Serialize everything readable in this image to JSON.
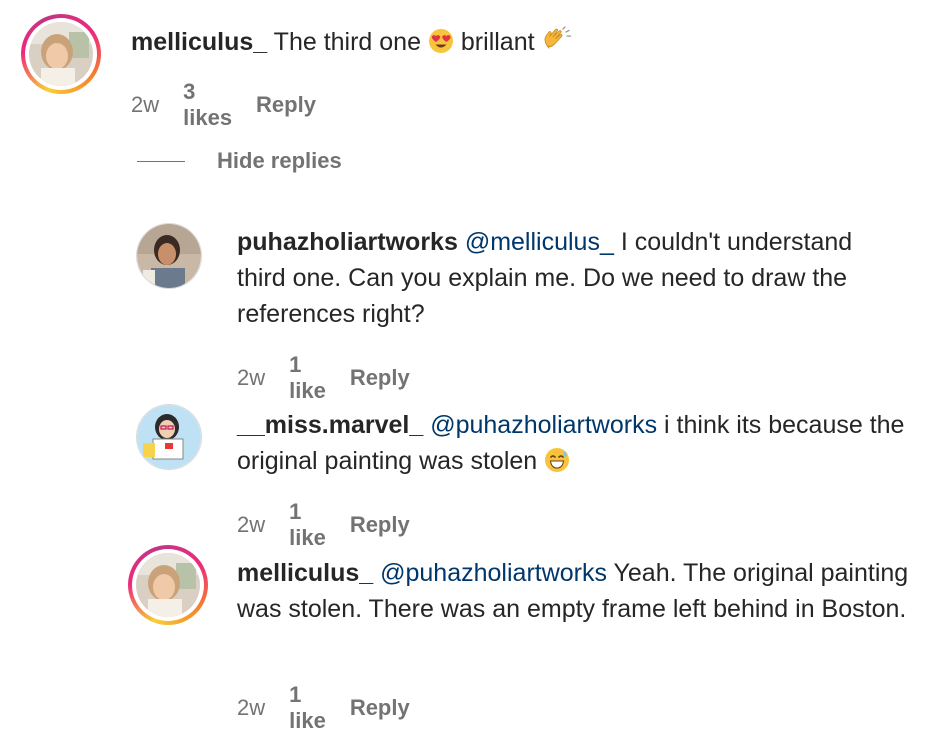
{
  "comments": [
    {
      "username": "melliculus_",
      "text": "The third one",
      "text2": "brillant",
      "time": "2w",
      "likes": "3 likes",
      "reply": "Reply"
    }
  ],
  "hide_replies": "Hide replies",
  "replies": [
    {
      "username": "puhazholiartworks",
      "mention": "@melliculus_",
      "text": "I couldn't understand third one. Can you explain me. Do we need to draw the references right?",
      "time": "2w",
      "likes": "1 like",
      "reply": "Reply"
    },
    {
      "username": "__miss.marvel_",
      "mention": "@puhazholiartworks",
      "text": "i think its because the original painting was stolen",
      "time": "2w",
      "likes": "1 like",
      "reply": "Reply"
    },
    {
      "username": "melliculus_",
      "mention": "@puhazholiartworks",
      "text": "Yeah. The original painting was stolen. There was an empty frame left behind in Boston.",
      "time": "2w",
      "likes": "1 like",
      "reply": "Reply"
    }
  ],
  "colors": {
    "text": "#262626",
    "meta": "#737373",
    "mention": "#00376b",
    "story_ring": [
      "#f9ce34",
      "#ee2a7b",
      "#c13584"
    ]
  },
  "icons": [
    "heart-eyes-emoji-icon",
    "clapping-hands-emoji-icon",
    "grinning-sweat-emoji-icon"
  ]
}
